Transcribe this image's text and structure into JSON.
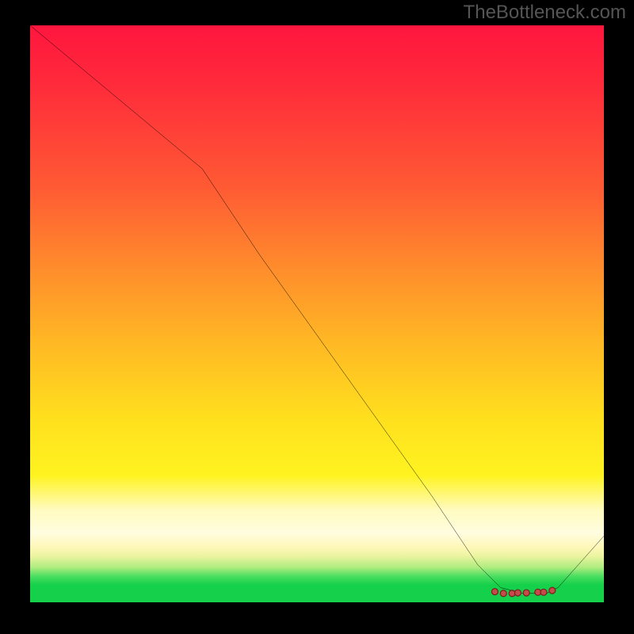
{
  "watermark": "TheBottleneck.com",
  "chart_data": {
    "type": "line",
    "title": "",
    "xlabel": "",
    "ylabel": "",
    "xlim": [
      0,
      100
    ],
    "ylim": [
      0,
      100
    ],
    "series": [
      {
        "name": "curve",
        "x": [
          0,
          12,
          24,
          30,
          40,
          50,
          60,
          70,
          78,
          82,
          86,
          90,
          92,
          100
        ],
        "values": [
          100,
          90,
          80,
          75,
          60,
          46,
          32,
          18,
          6,
          2,
          1,
          1,
          2,
          11
        ]
      }
    ],
    "markers": {
      "name": "points",
      "x": [
        81,
        82.5,
        84,
        85,
        86.5,
        88.5,
        89.5,
        91
      ],
      "values": [
        1.3,
        1.0,
        1.0,
        1.1,
        1.1,
        1.2,
        1.2,
        1.5
      ]
    },
    "gradient_stops": [
      {
        "pct": 0,
        "color": "#ff163e"
      },
      {
        "pct": 50,
        "color": "#ffb824"
      },
      {
        "pct": 78,
        "color": "#fff320"
      },
      {
        "pct": 95,
        "color": "#4ade60"
      },
      {
        "pct": 100,
        "color": "#15d04a"
      }
    ]
  }
}
